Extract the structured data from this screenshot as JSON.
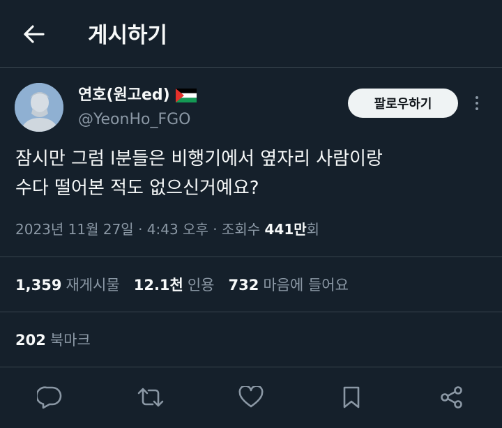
{
  "header": {
    "title": "게시하기",
    "back_icon": "arrow-left-icon"
  },
  "author": {
    "display_name": "연호(원고ed)",
    "handle": "@YeonHo_FGO",
    "flag_icon": "palestine-flag-icon"
  },
  "follow_label": "팔로우하기",
  "tweet": {
    "text": "잠시만 그럼 l분들은 비행기에서 옆자리 사람이랑\n수다 떨어본 적도 없으신거예요?"
  },
  "meta": {
    "timestamp": "2023년 11월 27일 · 4:43 오후 · 조회수",
    "views_value": "441만",
    "views_suffix": "회"
  },
  "stats": {
    "retweets_count": "1,359",
    "retweets_label": "재게시물",
    "quotes_count": "12.1천",
    "quotes_label": "인용",
    "likes_count": "732",
    "likes_label": "마음에 들어요",
    "bookmarks_count": "202",
    "bookmarks_label": "북마크"
  },
  "colors": {
    "background": "#15202b",
    "text": "#f7f9f9",
    "secondary": "#8b98a5",
    "border": "#38444d"
  },
  "action_icons": [
    "reply-icon",
    "retweet-icon",
    "like-icon",
    "bookmark-icon",
    "share-icon"
  ]
}
